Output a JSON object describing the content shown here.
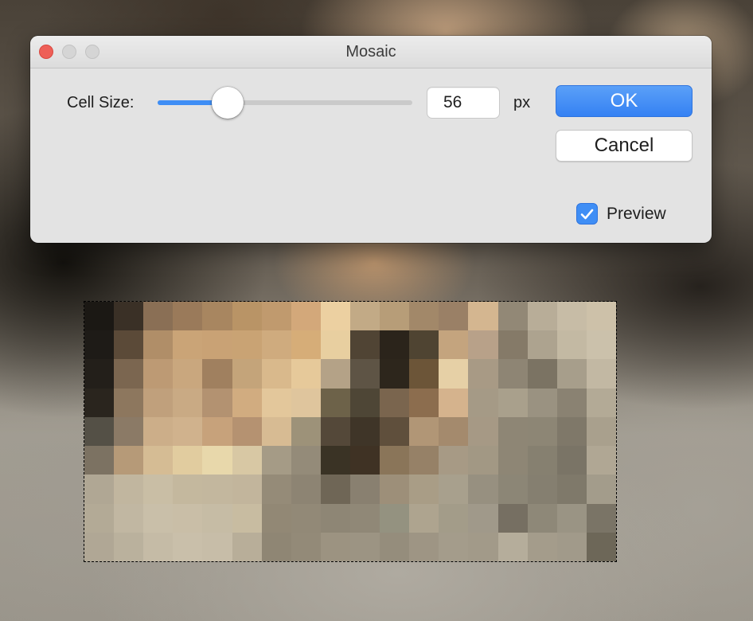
{
  "window": {
    "title": "Mosaic"
  },
  "controls": {
    "cell_size_label": "Cell Size:",
    "cell_size_slider": {
      "min": 1,
      "max": 200,
      "value": 56
    },
    "cell_size_value": "56",
    "unit_label": "px",
    "preview_checked": true,
    "preview_label": "Preview"
  },
  "buttons": {
    "ok_label": "OK",
    "cancel_label": "Cancel"
  },
  "colors": {
    "accent": "#3f8ef5",
    "close_light": "#ee5f57",
    "inactive_light": "#d5d5d5"
  },
  "mosaic": {
    "cols": 18,
    "rows": 9,
    "cells": [
      [
        "#1b1814",
        "#3a3026",
        "#8a6f55",
        "#9a7a5a",
        "#a88660",
        "#b99466",
        "#c09a6e",
        "#d3a87a",
        "#ecd0a1",
        "#c2aa86",
        "#b79d78",
        "#a28869",
        "#9a8066",
        "#d4b690",
        "#928876",
        "#b8ad98",
        "#c7bca6",
        "#cdc1a9"
      ],
      [
        "#1e1b17",
        "#5b4a38",
        "#b08e68",
        "#caa477",
        "#c9a275",
        "#c9a374",
        "#cfab7e",
        "#d6ad78",
        "#e8cfa0",
        "#504434",
        "#2b241b",
        "#4f4432",
        "#c4a47e",
        "#b8a189",
        "#857a68",
        "#ada38f",
        "#c3b9a3",
        "#cbc1ab"
      ],
      [
        "#231f1a",
        "#7b6650",
        "#bd9a74",
        "#c9a77e",
        "#a0805f",
        "#c4a47a",
        "#d9b98c",
        "#e6c99a",
        "#b4a287",
        "#5e5445",
        "#2d261c",
        "#6c5538",
        "#e6d0a6",
        "#a89a85",
        "#8e8574",
        "#7b7363",
        "#a79e8b",
        "#c2b8a3"
      ],
      [
        "#2a251e",
        "#8d775e",
        "#c0a07c",
        "#c9aa84",
        "#b39271",
        "#d1ac80",
        "#e3c79b",
        "#dfc59d",
        "#6d6249",
        "#4e4636",
        "#7a654e",
        "#8c6d4e",
        "#d5b38d",
        "#a59a86",
        "#a9a08c",
        "#9a9281",
        "#8a8272",
        "#b3aa96"
      ],
      [
        "#545046",
        "#8b7a66",
        "#ccae89",
        "#d0b28d",
        "#c7a27b",
        "#b59271",
        "#d7bb93",
        "#9d9279",
        "#544839",
        "#3f3528",
        "#5f4f3c",
        "#b19676",
        "#a48a6d",
        "#a69985",
        "#8e8675",
        "#8d8675",
        "#7f7869",
        "#a9a08d"
      ],
      [
        "#7c7262",
        "#b69a78",
        "#d5bc94",
        "#e1cc9f",
        "#e8d8ab",
        "#d8c8a4",
        "#a59b86",
        "#948b79",
        "#3a3325",
        "#3f3224",
        "#8a7559",
        "#968167",
        "#a79a85",
        "#a29884",
        "#8e8675",
        "#868070",
        "#7a7466",
        "#b0a794"
      ],
      [
        "#b0a794",
        "#c1b69f",
        "#c9bea5",
        "#c4b89e",
        "#c3b79e",
        "#c2b59c",
        "#958b78",
        "#8d8473",
        "#6f6656",
        "#898070",
        "#9d8f79",
        "#a99d86",
        "#a8a08d",
        "#979080",
        "#8c8676",
        "#857f70",
        "#7f796a",
        "#a39c8b"
      ],
      [
        "#b3aa96",
        "#c1b7a2",
        "#c9bfa9",
        "#c9bea7",
        "#c6bca5",
        "#c8bca1",
        "#928875",
        "#928977",
        "#8e8675",
        "#908877",
        "#949280",
        "#aea48f",
        "#a39c89",
        "#a0998a",
        "#766f62",
        "#8e8878",
        "#9a9484",
        "#7a7466"
      ],
      [
        "#b0a795",
        "#bab19d",
        "#c5bba6",
        "#c9bfaa",
        "#c7bda8",
        "#b8ae99",
        "#8f8674",
        "#938a78",
        "#9c9381",
        "#9c9483",
        "#958d7c",
        "#9e9584",
        "#a49c8b",
        "#a29a89",
        "#b5ad9b",
        "#a49c8b",
        "#a19a8a",
        "#6d6758"
      ]
    ]
  }
}
